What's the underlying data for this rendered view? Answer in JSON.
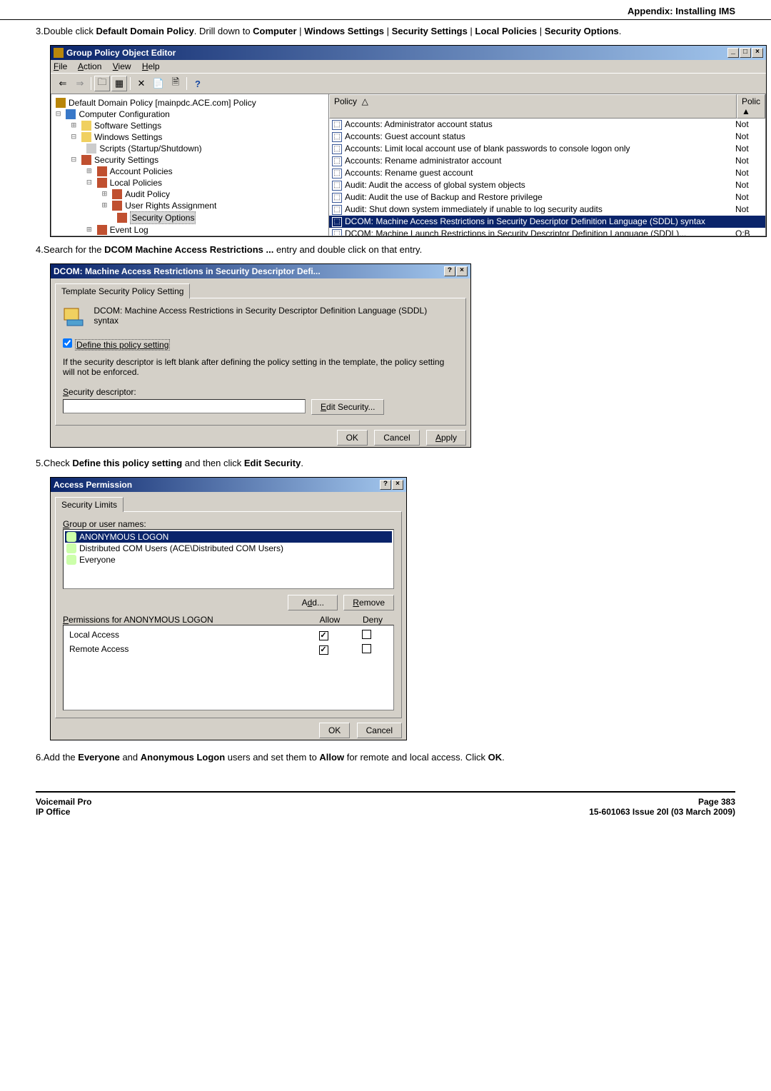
{
  "header": {
    "title": "Appendix: Installing IMS"
  },
  "steps": {
    "s3a": "Double click ",
    "s3b": "Default Domain Policy",
    "s3c": ". Drill down to ",
    "s3d": "Computer",
    "s3e": "Windows Settings",
    "s3f": "Security Settings",
    "s3g": "Local Policies",
    "s3h": "Security Options",
    "s4a": "Search for the ",
    "s4b": "DCOM Machine Access Restrictions ...",
    "s4c": " entry and double click on that entry.",
    "s5a": "Check ",
    "s5b": "Define this policy setting",
    "s5c": " and then click ",
    "s5d": "Edit Security",
    "s6a": "Add the ",
    "s6b": "Everyone",
    "s6c": " and ",
    "s6d": "Anonymous Logon",
    "s6e": " users and set them to ",
    "s6f": "Allow",
    "s6g": " for remote and local access. Click ",
    "s6h": "OK"
  },
  "gpe": {
    "title": "Group Policy Object Editor",
    "menu": {
      "file": "File",
      "action": "Action",
      "view": "View",
      "help": "Help"
    },
    "tree": {
      "root": "Default Domain Policy [mainpdc.ACE.com] Policy",
      "n1": "Computer Configuration",
      "n2": "Software Settings",
      "n3": "Windows Settings",
      "n4": "Scripts (Startup/Shutdown)",
      "n5": "Security Settings",
      "n6": "Account Policies",
      "n7": "Local Policies",
      "n8": "Audit Policy",
      "n9": "User Rights Assignment",
      "n10": "Security Options",
      "n11": "Event Log"
    },
    "cols": {
      "policy": "Policy",
      "setting": "Polic"
    },
    "rows": [
      {
        "label": "Accounts: Administrator account status",
        "val": "Not"
      },
      {
        "label": "Accounts: Guest account status",
        "val": "Not"
      },
      {
        "label": "Accounts: Limit local account use of blank passwords to console logon only",
        "val": "Not"
      },
      {
        "label": "Accounts: Rename administrator account",
        "val": "Not"
      },
      {
        "label": "Accounts: Rename guest account",
        "val": "Not"
      },
      {
        "label": "Audit: Audit the access of global system objects",
        "val": "Not"
      },
      {
        "label": "Audit: Audit the use of Backup and Restore privilege",
        "val": "Not"
      },
      {
        "label": "Audit: Shut down system immediately if unable to log security audits",
        "val": "Not"
      },
      {
        "label": "DCOM: Machine Access Restrictions in Security Descriptor Definition Language (SDDL) syntax",
        "val": "",
        "selected": true
      },
      {
        "label": "DCOM: Machine Launch Restrictions in Security Descriptor Definition Language (SDDL)...",
        "val": "O:B"
      }
    ]
  },
  "dlg1": {
    "title": "DCOM: Machine Access Restrictions in Security Descriptor Defi...",
    "tab": "Template Security Policy Setting",
    "heading": "DCOM: Machine Access Restrictions in Security Descriptor Definition Language (SDDL) syntax",
    "chk": "Define this policy setting",
    "note": "If the security descriptor is left blank after defining the policy setting in the template, the policy setting will not be enforced.",
    "sd": "Security descriptor:",
    "edit": "Edit Security...",
    "ok": "OK",
    "cancel": "Cancel",
    "apply": "Apply"
  },
  "dlg2": {
    "title": "Access Permission",
    "tab": "Security Limits",
    "groups": "Group or user names:",
    "names": [
      {
        "label": "ANONYMOUS LOGON",
        "selected": true
      },
      {
        "label": "Distributed COM Users (ACE\\Distributed COM Users)"
      },
      {
        "label": "Everyone"
      }
    ],
    "add": "Add...",
    "remove": "Remove",
    "perms_for": "Permissions for ANONYMOUS LOGON",
    "allow": "Allow",
    "deny": "Deny",
    "perms": [
      {
        "label": "Local Access",
        "allow": true,
        "deny": false
      },
      {
        "label": "Remote Access",
        "allow": true,
        "deny": false
      }
    ],
    "ok": "OK",
    "cancel": "Cancel"
  },
  "footer": {
    "l1": "Voicemail Pro",
    "l2": "IP Office",
    "r1": "Page 383",
    "r2": "15-601063 Issue 20l (03 March 2009)"
  }
}
